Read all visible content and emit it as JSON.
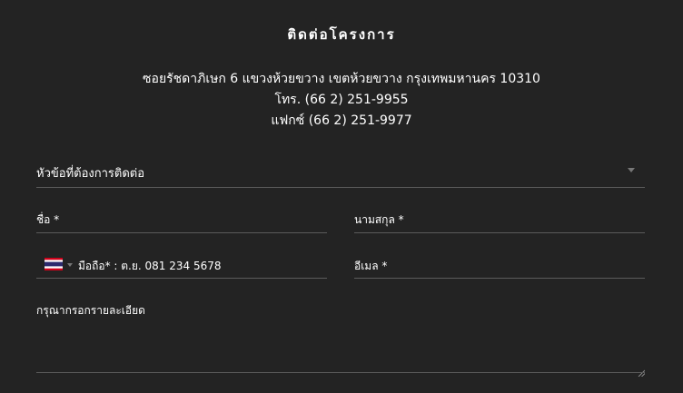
{
  "contact": {
    "title": "ติดต่อโครงการ",
    "address_lines": [
      "ซอยรัชดาภิเษก 6 แขวงห้วยขวาง เขตห้วยขวาง กรุงเทพมหานคร 10310",
      "โทร. (66 2) 251-9955",
      "แฟกซ์ (66 2) 251-9977"
    ]
  },
  "form": {
    "subject_label": "หัวข้อที่ต้องการติดต่อ",
    "first_name_label": "ชื่อ *",
    "last_name_label": "นามสกุล *",
    "phone_label": "มือถือ* : ต.ย. 081 234 5678",
    "email_label": "อีเมล *",
    "details_label": "กรุณากรอกรายละเอียด"
  },
  "colors": {
    "background": "#232323",
    "text": "#ffffff",
    "underline": "#5b5b5b",
    "arrow": "#777777"
  },
  "icons": {
    "country_flag": "thailand-flag-icon",
    "dropdown": "chevron-down-icon",
    "resize": "resize-handle-icon"
  }
}
